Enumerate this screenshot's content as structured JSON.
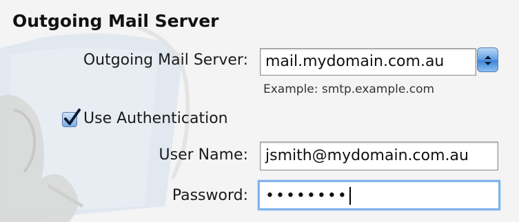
{
  "section_title": "Outgoing Mail Server",
  "server": {
    "label": "Outgoing Mail Server:",
    "value": "mail.mydomain.com.au",
    "hint": "Example: smtp.example.com"
  },
  "authentication": {
    "label": "Use Authentication",
    "checked": true
  },
  "username": {
    "label": "User Name:",
    "value": "jsmith@mydomain.com.au"
  },
  "password": {
    "label": "Password:",
    "masked_value": "••••••••"
  },
  "colors": {
    "background": "#f4f4f4",
    "focus_ring": "#7fb2ec",
    "dropdown_blue": "#3f86d8",
    "checkmark": "#0b1a33"
  },
  "icons": [
    "popup-arrows-icon",
    "checkmark-icon",
    "eagle-watermark-icon"
  ]
}
